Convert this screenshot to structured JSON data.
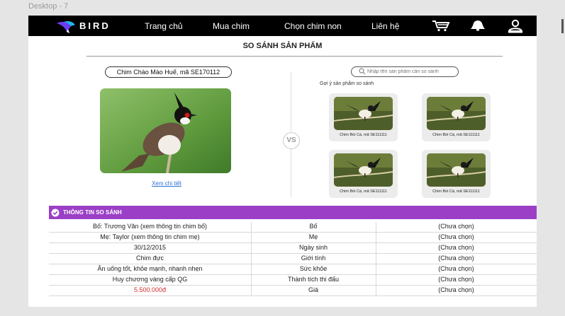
{
  "frame_label": "Desktop - 7",
  "nav": {
    "brand": "BIRD",
    "links": [
      "Trang chủ",
      "Mua chim",
      "Chọn chim non",
      "Liên hệ"
    ],
    "icons": [
      "cart-icon",
      "bell-icon",
      "user-icon"
    ]
  },
  "page_title": "SO SÁNH SẢN PHẨM",
  "product": {
    "name": "Chim Chào Mào Huế, mã SE170112",
    "detail_link": "Xem chi tiết"
  },
  "vs_label": "VS",
  "search": {
    "placeholder": "Nhập tên sản phẩm cần so sánh"
  },
  "suggest": {
    "label": "Gợi ý sản phẩm so sánh",
    "items": [
      "Chim Bói Cá, mã SE111111",
      "Chim Bói Cá, mã SE111111",
      "Chim Bói Cá, mã SE111111",
      "Chim Bói Cá, mã SE111111"
    ]
  },
  "compare": {
    "header": "THÔNG TIN SO SÁNH",
    "rows": [
      {
        "left": "Bố: Trương Văn (xem thông tin chim bố)",
        "attr": "Bố",
        "right": "(Chưa chọn)"
      },
      {
        "left": "Mẹ: Taylor (xem thông tin chim mẹ)",
        "attr": "Mẹ",
        "right": "(Chưa chọn)"
      },
      {
        "left": "30/12/2015",
        "attr": "Ngày sinh",
        "right": "(Chưa chọn)"
      },
      {
        "left": "Chim đực",
        "attr": "Giới tính",
        "right": "(Chưa chọn)"
      },
      {
        "left": "Ăn uống tốt, khỏe mạnh, nhanh nhẹn",
        "attr": "Sức khỏe",
        "right": "(Chưa chọn)"
      },
      {
        "left": "Huy chương vàng cấp QG",
        "attr": "Thành tích thi đấu",
        "right": "(Chưa chọn)"
      },
      {
        "left": "5.500.000đ",
        "attr": "Giá",
        "right": "(Chưa chọn)"
      }
    ]
  },
  "colors": {
    "nav_bg": "#000000",
    "accent_purple": "#9b3fc6",
    "price_red": "#d42b2b",
    "link_blue": "#2d6fd6"
  }
}
